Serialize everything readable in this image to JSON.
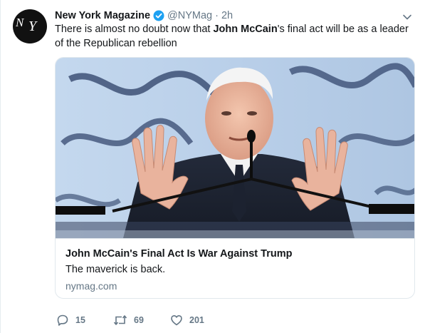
{
  "tweet": {
    "avatar": {
      "logo_text": "New York",
      "background": "#111111"
    },
    "author": {
      "name": "New York Magazine",
      "verified": true,
      "handle": "@NYMag",
      "separator": "·",
      "time": "2h"
    },
    "text": {
      "part1": "There is almost no doubt now that ",
      "bold": "John McCain",
      "part2": "'s final act will be as a leader of the Republican rebellion"
    },
    "card": {
      "title": "John McCain's Final Act Is War Against Trump",
      "description": "The maverick is back.",
      "domain": "nymag.com"
    },
    "actions": {
      "replies": "15",
      "retweets": "69",
      "likes": "201"
    }
  },
  "colors": {
    "text": "#14171a",
    "muted": "#657786",
    "border": "#e1e8ed",
    "verified": "#1da1f2"
  },
  "icons": {
    "verified": "verified-badge-icon",
    "caret": "chevron-down-icon",
    "reply": "reply-icon",
    "retweet": "retweet-icon",
    "like": "heart-icon"
  }
}
